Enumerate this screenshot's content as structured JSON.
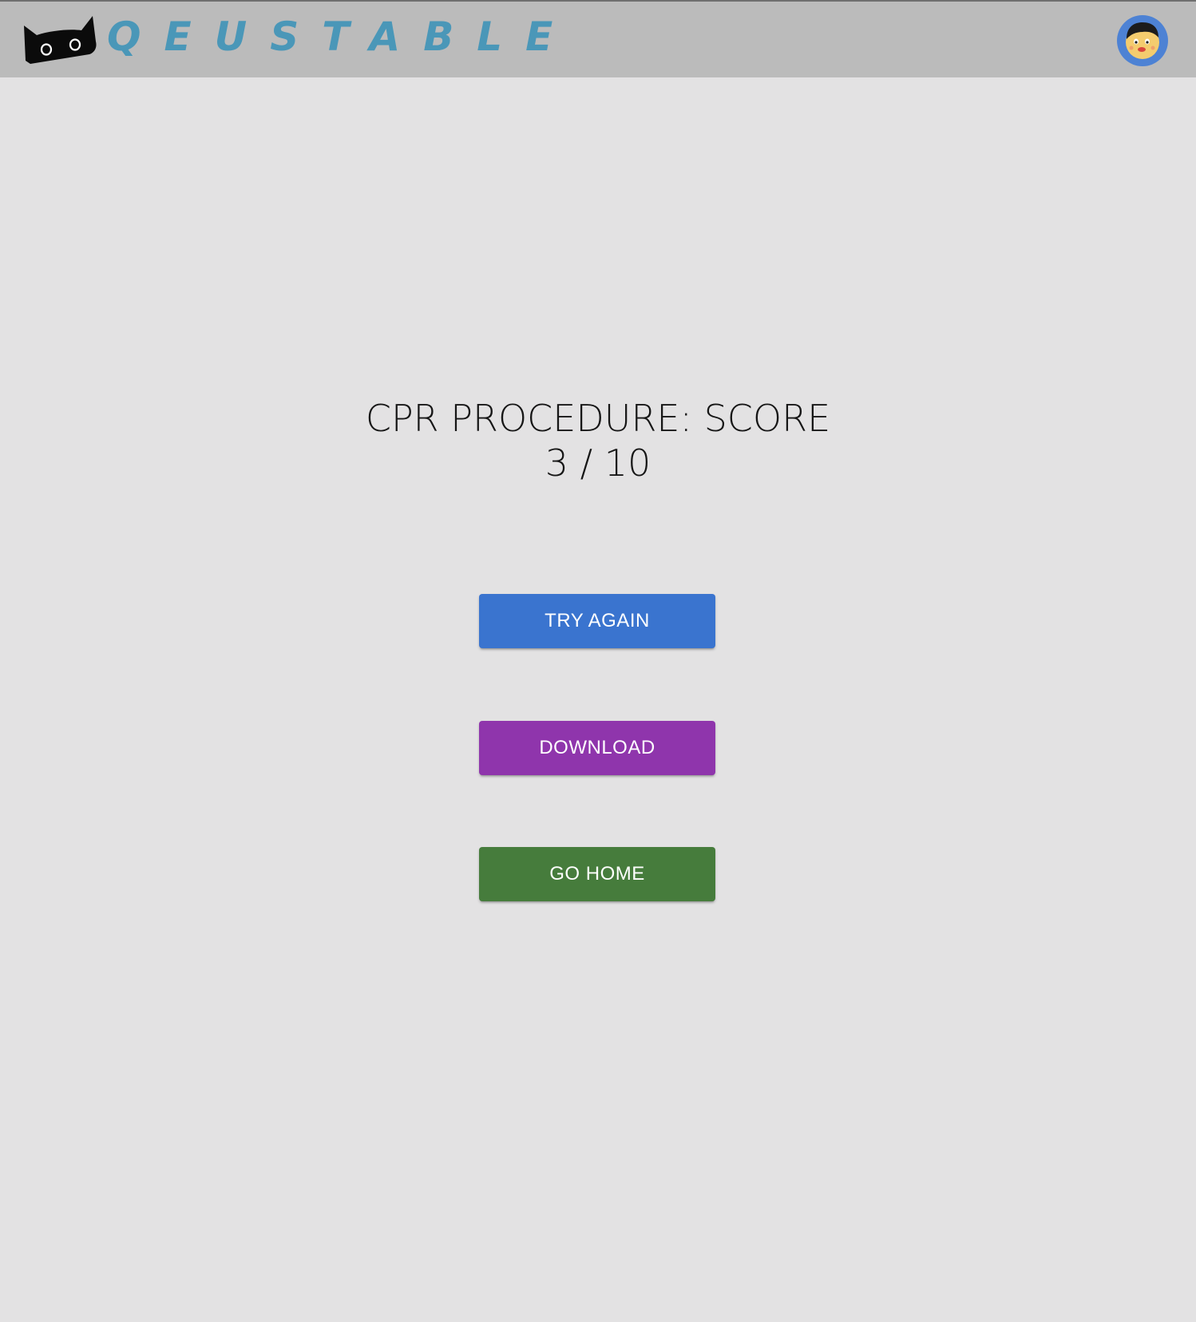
{
  "header": {
    "brand": "QEUSTABLE",
    "logo_icon": "cat-logo-icon",
    "avatar_icon": "user-avatar-icon"
  },
  "result": {
    "line1": "CPR PROCEDURE: SCORE",
    "line2": "3 / 10",
    "score": 3,
    "max_score": 10
  },
  "actions": {
    "try_again": "TRY AGAIN",
    "download": "DOWNLOAD",
    "go_home": "GO HOME"
  },
  "colors": {
    "header_bg": "#bbbbbb",
    "page_bg": "#e3e2e3",
    "brand_text": "#4a97b8",
    "try_again": "#3a74cf",
    "download": "#8f35ac",
    "go_home": "#467c3c",
    "avatar_ring": "#4d82d4"
  }
}
